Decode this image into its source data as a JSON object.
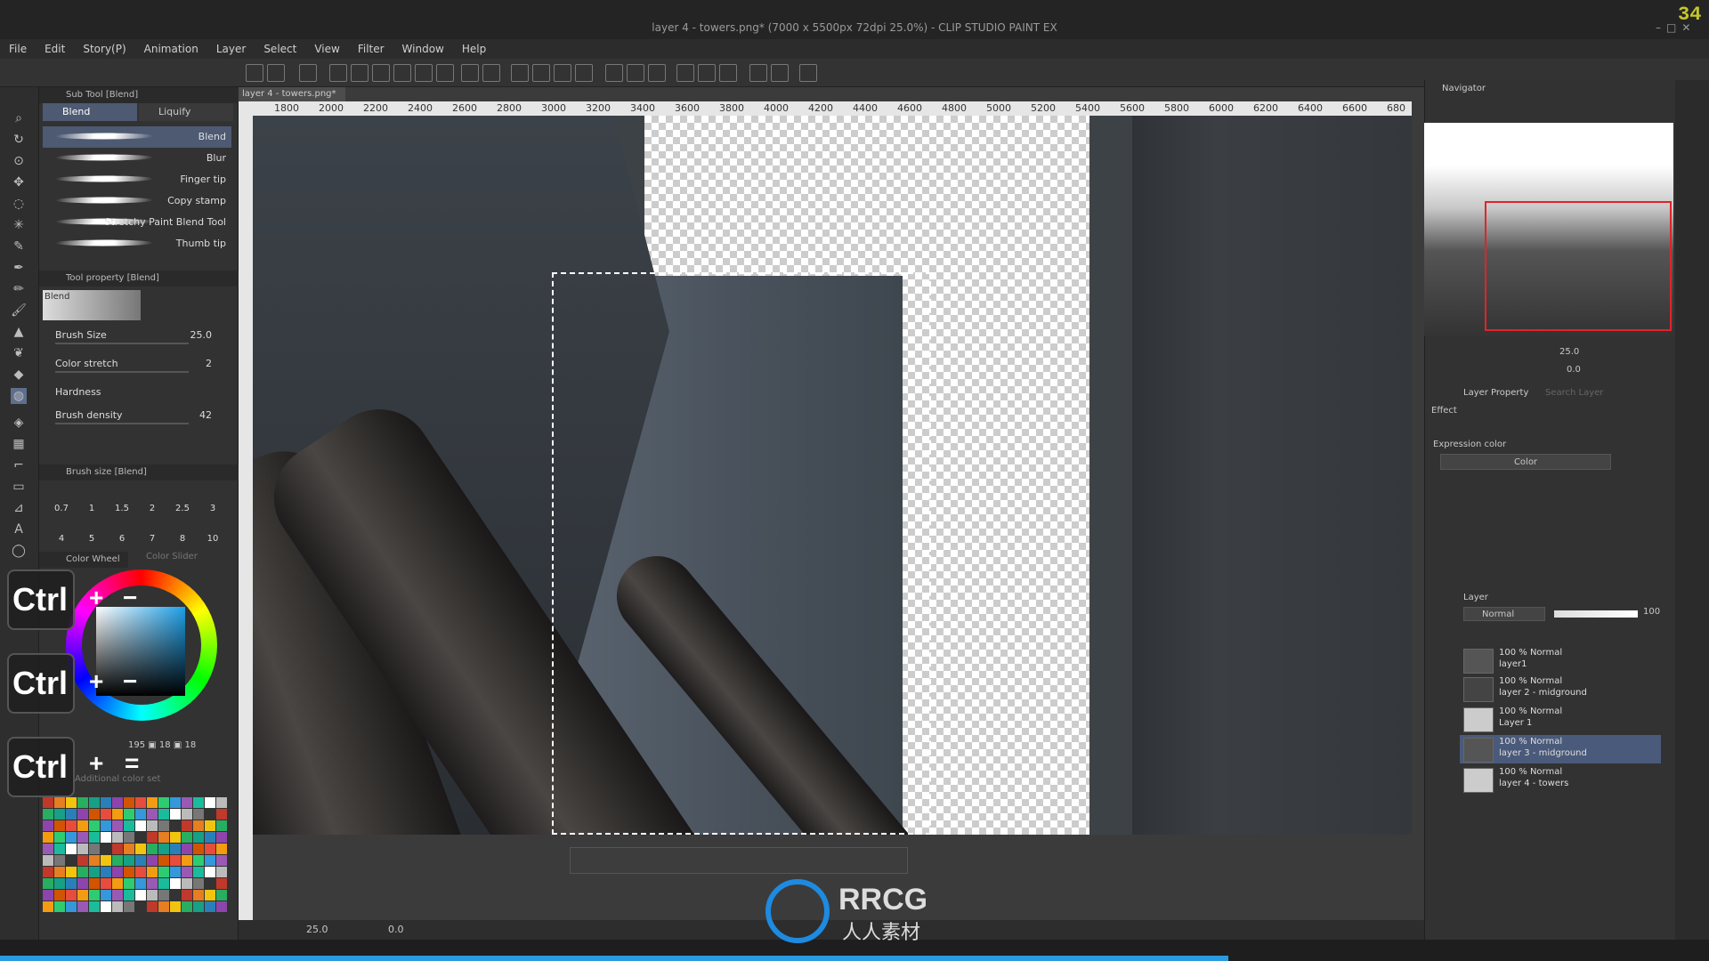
{
  "window": {
    "title": "layer 4 - towers.png* (7000 x 5500px 72dpi 25.0%) - CLIP STUDIO PAINT EX",
    "fps": "34"
  },
  "menu": [
    "File",
    "Edit",
    "Story(P)",
    "Animation",
    "Layer",
    "Select",
    "View",
    "Filter",
    "Window",
    "Help"
  ],
  "subtool": {
    "header": "Sub Tool [Blend]",
    "tabs": [
      "Blend",
      "Liquify"
    ],
    "brushes": [
      "Blend",
      "Blur",
      "Finger tip",
      "Copy stamp",
      "Stretchy Paint Blend Tool",
      "Thumb tip"
    ]
  },
  "tool_property": {
    "header": "Tool property [Blend]",
    "preview_label": "Blend",
    "brush_size_label": "Brush Size",
    "brush_size_value": "25.0",
    "color_stretch_label": "Color stretch",
    "color_stretch_value": "2",
    "hardness_label": "Hardness",
    "brush_density_label": "Brush density",
    "brush_density_value": "42"
  },
  "brush_size_panel": {
    "header": "Brush size [Blend]",
    "row1": [
      "0.7",
      "1",
      "1.5",
      "2",
      "2.5",
      "3"
    ],
    "row2": [
      "4",
      "5",
      "6",
      "7",
      "8",
      "10"
    ]
  },
  "color_panel": {
    "tab1": "Color Wheel",
    "tab2": "Color Slider",
    "rgb": [
      "195",
      "18",
      "18"
    ],
    "color_set_placeholder": "Additional color set"
  },
  "overlay_keys": {
    "ctrl": "Ctrl",
    "plus": "+",
    "minus": "−",
    "equals": "="
  },
  "canvas": {
    "doc_tab": "layer 4 - towers.png*",
    "ruler": [
      "1800",
      "2000",
      "2200",
      "2400",
      "2600",
      "2800",
      "3000",
      "3200",
      "3400",
      "3600",
      "3800",
      "4000",
      "4200",
      "4400",
      "4600",
      "4800",
      "5000",
      "5200",
      "5400",
      "5600",
      "5800",
      "6000",
      "6200",
      "6400",
      "6600",
      "680"
    ],
    "zoom": "25.0",
    "rotation": "0.0"
  },
  "navigator": {
    "header": "Navigator",
    "zoom": "25.0",
    "rotation": "0.0"
  },
  "layer_property": {
    "header": "Layer Property",
    "search_tab": "Search Layer",
    "effect_label": "Effect",
    "expression_color_label": "Expression color",
    "expression_color_value": "Color"
  },
  "layers": {
    "header": "Layer",
    "blend_mode": "Normal",
    "opacity": "100",
    "items": [
      {
        "mode": "100 % Normal",
        "name": "layer1"
      },
      {
        "mode": "100 % Normal",
        "name": "layer 2 - midground"
      },
      {
        "mode": "100 % Normal",
        "name": "Layer 1"
      },
      {
        "mode": "100 % Normal",
        "name": "layer 3 - midground"
      },
      {
        "mode": "100 % Normal",
        "name": "layer 4 - towers"
      }
    ]
  },
  "watermark": {
    "brand": "RRCG",
    "sub": "人人素材"
  },
  "colors": {
    "accent": "#2a9be0",
    "selected_layer": "#4a5a7a",
    "nav_frame": "#e0242a"
  }
}
